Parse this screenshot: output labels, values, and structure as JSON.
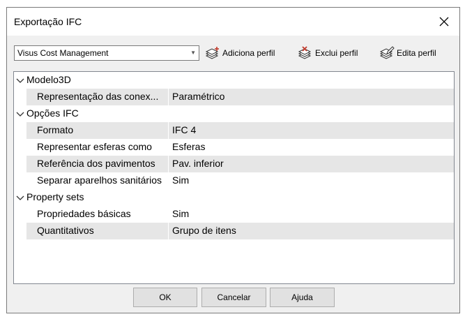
{
  "window": {
    "title": "Exportação IFC"
  },
  "toolbar": {
    "profile_selected": "Visus Cost Management",
    "add_label": "Adiciona perfil",
    "delete_label": "Exclui perfil",
    "edit_label": "Edita perfil"
  },
  "grid": {
    "categories": [
      {
        "label": "Modelo3D",
        "props": [
          {
            "name": "Representação das conex...",
            "value": "Paramétrico"
          }
        ]
      },
      {
        "label": "Opções IFC",
        "props": [
          {
            "name": "Formato",
            "value": "IFC 4"
          },
          {
            "name": "Representar esferas como",
            "value": "Esferas"
          },
          {
            "name": "Referência dos pavimentos",
            "value": "Pav. inferior"
          },
          {
            "name": "Separar aparelhos sanitários",
            "value": "Sim"
          }
        ]
      },
      {
        "label": "Property sets",
        "props": [
          {
            "name": "Propriedades básicas",
            "value": "Sim"
          },
          {
            "name": "Quantitativos",
            "value": "Grupo de itens"
          }
        ]
      }
    ]
  },
  "footer": {
    "ok_label": "OK",
    "cancel_label": "Cancelar",
    "help_label": "Ajuda"
  }
}
